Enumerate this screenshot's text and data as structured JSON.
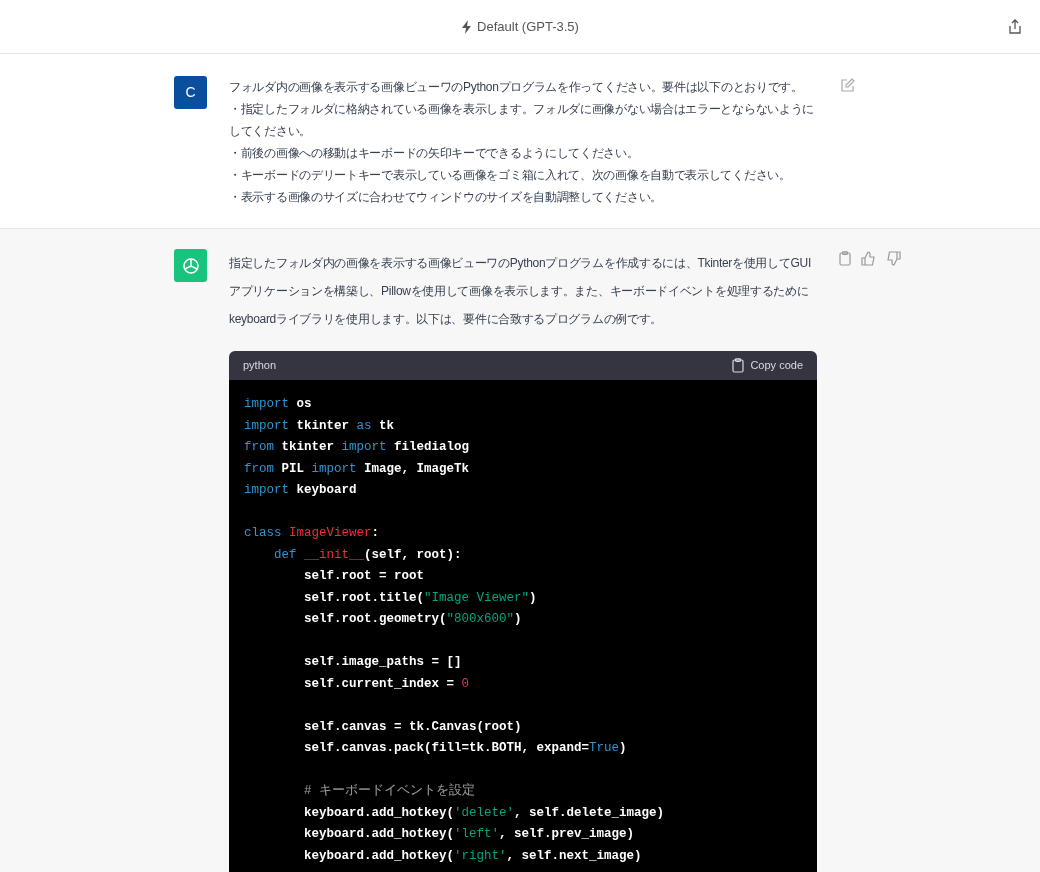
{
  "header": {
    "model_label": "Default (GPT-3.5)"
  },
  "messages": [
    {
      "kind": "user",
      "avatar": "C",
      "lines": [
        "フォルダ内の画像を表示する画像ビューワのPythonプログラムを作ってください。要件は以下のとおりです。",
        "・指定したフォルダに格納されている画像を表示します。フォルダに画像がない場合はエラーとならないようにしてください。",
        "・前後の画像への移動はキーボードの矢印キーでできるようにしてください。",
        "・キーボードのデリートキーで表示している画像をゴミ箱に入れて、次の画像を自動で表示してください。",
        "・表示する画像のサイズに合わせてウィンドウのサイズを自動調整してください。"
      ]
    },
    {
      "kind": "assistant",
      "lines": [
        "指定したフォルダ内の画像を表示する画像ビューワのPythonプログラムを作成するには、Tkinterを使用してGUIアプリケーションを構築し、Pillowを使用して画像を表示します。また、キーボードイベントを処理するためにkeyboardライブラリを使用します。以下は、要件に合致するプログラムの例です。"
      ],
      "code": {
        "language": "python",
        "copy_label": "Copy code",
        "lines": [
          {
            "tokens": [
              {
                "kind": "kw",
                "text": "import"
              },
              {
                "kind": "plain",
                "text": " os"
              }
            ]
          },
          {
            "tokens": [
              {
                "kind": "kw",
                "text": "import"
              },
              {
                "kind": "plain",
                "text": " tkinter "
              },
              {
                "kind": "kw",
                "text": "as"
              },
              {
                "kind": "plain",
                "text": " tk"
              }
            ]
          },
          {
            "tokens": [
              {
                "kind": "kw",
                "text": "from"
              },
              {
                "kind": "plain",
                "text": " tkinter "
              },
              {
                "kind": "kw",
                "text": "import"
              },
              {
                "kind": "plain",
                "text": " filedialog"
              }
            ]
          },
          {
            "tokens": [
              {
                "kind": "kw",
                "text": "from"
              },
              {
                "kind": "plain",
                "text": " PIL "
              },
              {
                "kind": "kw",
                "text": "import"
              },
              {
                "kind": "plain",
                "text": " Image, ImageTk"
              }
            ]
          },
          {
            "tokens": [
              {
                "kind": "kw",
                "text": "import"
              },
              {
                "kind": "plain",
                "text": " keyboard"
              }
            ]
          },
          {
            "kind": "blank"
          },
          {
            "tokens": [
              {
                "kind": "kw",
                "text": "class"
              },
              {
                "kind": "name",
                "text": " ImageViewer"
              },
              {
                "kind": "plain",
                "text": ":"
              }
            ],
            "children": [
              {
                "tokens": [
                  {
                    "kind": "kw",
                    "text": "def"
                  },
                  {
                    "kind": "name",
                    "text": " __init__"
                  },
                  {
                    "kind": "plain",
                    "text": "(self, root):"
                  }
                ],
                "children": [
                  {
                    "tokens": [
                      {
                        "kind": "plain",
                        "text": "self.root = root"
                      }
                    ]
                  },
                  {
                    "tokens": [
                      {
                        "kind": "plain",
                        "text": "self.root.title("
                      },
                      {
                        "kind": "str",
                        "text": "\"Image Viewer\""
                      },
                      {
                        "kind": "plain",
                        "text": ")"
                      }
                    ]
                  },
                  {
                    "tokens": [
                      {
                        "kind": "plain",
                        "text": "self.root.geometry("
                      },
                      {
                        "kind": "str",
                        "text": "\"800x600\""
                      },
                      {
                        "kind": "plain",
                        "text": ")"
                      }
                    ]
                  },
                  {
                    "kind": "blank"
                  },
                  {
                    "tokens": [
                      {
                        "kind": "plain",
                        "text": "self.image_paths = []"
                      }
                    ]
                  },
                  {
                    "tokens": [
                      {
                        "kind": "plain",
                        "text": "self.current_index = "
                      },
                      {
                        "kind": "num",
                        "text": "0"
                      }
                    ]
                  },
                  {
                    "kind": "blank"
                  },
                  {
                    "tokens": [
                      {
                        "kind": "plain",
                        "text": "self.canvas = tk.Canvas(root)"
                      }
                    ]
                  },
                  {
                    "tokens": [
                      {
                        "kind": "plain",
                        "text": "self.canvas.pack(fill=tk.BOTH, expand="
                      },
                      {
                        "kind": "kw",
                        "text": "True"
                      },
                      {
                        "kind": "plain",
                        "text": ")"
                      }
                    ]
                  },
                  {
                    "kind": "blank"
                  },
                  {
                    "tokens": [
                      {
                        "kind": "cmt",
                        "text": "# キーボードイベントを設定"
                      }
                    ]
                  },
                  {
                    "tokens": [
                      {
                        "kind": "plain",
                        "text": "keyboard.add_hotkey("
                      },
                      {
                        "kind": "str",
                        "text": "'delete'"
                      },
                      {
                        "kind": "plain",
                        "text": ", self.delete_image)"
                      }
                    ]
                  },
                  {
                    "tokens": [
                      {
                        "kind": "plain",
                        "text": "keyboard.add_hotkey("
                      },
                      {
                        "kind": "str",
                        "text": "'left'"
                      },
                      {
                        "kind": "plain",
                        "text": ", self.prev_image)"
                      }
                    ]
                  },
                  {
                    "tokens": [
                      {
                        "kind": "plain",
                        "text": "keyboard.add_hotkey("
                      },
                      {
                        "kind": "str",
                        "text": "'right'"
                      },
                      {
                        "kind": "plain",
                        "text": ", self.next_image)"
                      }
                    ]
                  }
                ]
              }
            ]
          }
        ]
      }
    }
  ]
}
